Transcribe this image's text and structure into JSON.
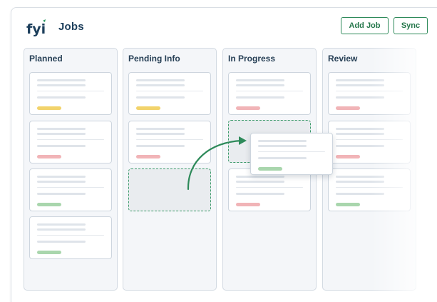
{
  "header": {
    "logo_text": "fyi",
    "title": "Jobs",
    "add_job_label": "Add Job",
    "sync_label": "Sync"
  },
  "columns": [
    {
      "title": "Planned",
      "cards": [
        "yellow",
        "red",
        "green",
        "green"
      ]
    },
    {
      "title": "Pending Info",
      "cards": [
        "yellow",
        "red"
      ]
    },
    {
      "title": "In Progress",
      "cards": [
        "red",
        "red"
      ]
    },
    {
      "title": "Review",
      "cards": [
        "red",
        "red",
        "green"
      ]
    }
  ],
  "colors": {
    "brand": "#1d3f5c",
    "accent": "#2e8a5a",
    "tag_yellow": "#f2d36b",
    "tag_red": "#f1b4b7",
    "tag_green": "#a9d6ad"
  },
  "icons": [
    "fyi-logo-icon",
    "drag-arrow-icon"
  ]
}
